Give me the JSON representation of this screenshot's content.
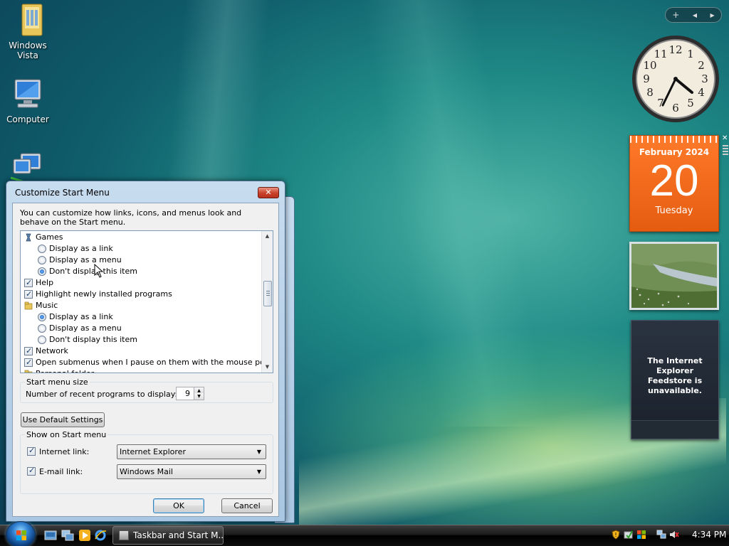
{
  "desktop": {
    "icons": [
      {
        "label": "Windows Vista"
      },
      {
        "label": "Computer"
      },
      {
        "label": ""
      }
    ]
  },
  "sidebar": {
    "add_symbol": "+",
    "prev_symbol": "◀",
    "next_symbol": "▶",
    "calendar": {
      "month": "February 2024",
      "day": "20",
      "weekday": "Tuesday"
    },
    "feed_message": "The Internet Explorer Feedstore is unavailable.",
    "close_symbol": "✕"
  },
  "dialog": {
    "title": "Customize Start Menu",
    "close_symbol": "✕",
    "intro": "You can customize how links, icons, and menus look and behave on the Start menu.",
    "items": [
      {
        "type": "category",
        "label": "Games",
        "icon": "games-icon"
      },
      {
        "type": "radio",
        "label": "Display as a link",
        "checked": false
      },
      {
        "type": "radio",
        "label": "Display as a menu",
        "checked": false
      },
      {
        "type": "radio",
        "label": "Don't display this item",
        "checked": true
      },
      {
        "type": "check",
        "label": "Help",
        "checked": true
      },
      {
        "type": "check",
        "label": "Highlight newly installed programs",
        "checked": true
      },
      {
        "type": "category",
        "label": "Music",
        "icon": "music-folder-icon"
      },
      {
        "type": "radio",
        "label": "Display as a link",
        "checked": true
      },
      {
        "type": "radio",
        "label": "Display as a menu",
        "checked": false
      },
      {
        "type": "radio",
        "label": "Don't display this item",
        "checked": false
      },
      {
        "type": "check",
        "label": "Network",
        "checked": true
      },
      {
        "type": "check",
        "label": "Open submenus when I pause on them with the mouse pointer",
        "checked": true
      },
      {
        "type": "category",
        "label": "Personal folder",
        "icon": "personal-folder-icon"
      }
    ],
    "start_menu_size": {
      "group_label": "Start menu size",
      "recent_label": "Number of recent programs to display:",
      "recent_value": "9"
    },
    "default_button": "Use Default Settings",
    "show_on_start": {
      "group_label": "Show on Start menu",
      "internet_label": "Internet link:",
      "internet_checked": true,
      "internet_value": "Internet Explorer",
      "email_label": "E-mail link:",
      "email_checked": true,
      "email_value": "Windows Mail"
    },
    "ok_button": "OK",
    "cancel_button": "Cancel"
  },
  "taskbar": {
    "task_label": "Taskbar and Start M...",
    "time": "4:34 PM"
  },
  "colors": {
    "taskbar": "#000000",
    "calendar": "#e55c10",
    "accent_blue": "#3c7fb1"
  }
}
